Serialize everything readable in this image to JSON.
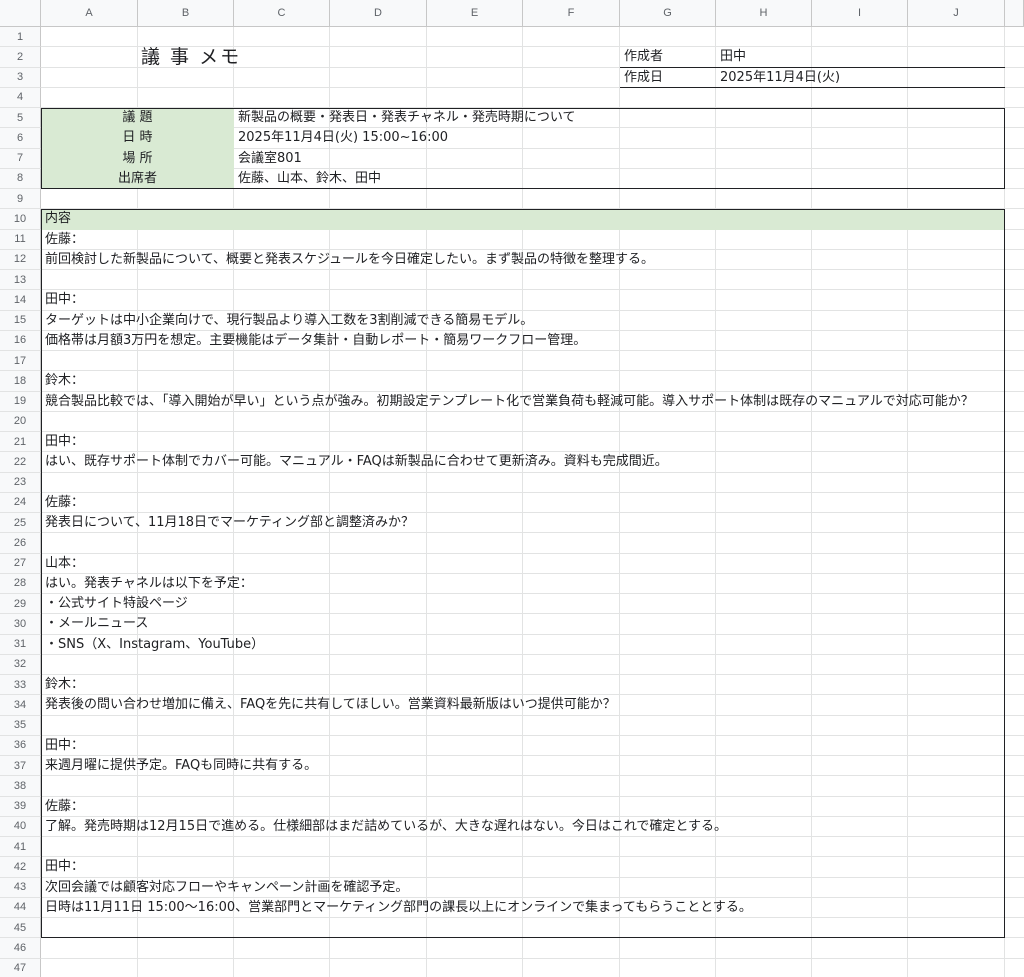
{
  "columns": [
    "A",
    "B",
    "C",
    "D",
    "E",
    "F",
    "G",
    "H",
    "I",
    "J"
  ],
  "rows": [
    "1",
    "2",
    "3",
    "4",
    "5",
    "6",
    "7",
    "8",
    "9",
    "10",
    "11",
    "12",
    "13",
    "14",
    "15",
    "16",
    "17",
    "18",
    "19",
    "20",
    "21",
    "22",
    "23",
    "24",
    "25",
    "26",
    "27",
    "28",
    "29",
    "30",
    "31",
    "32",
    "33",
    "34",
    "35",
    "36",
    "37",
    "38",
    "39",
    "40",
    "41",
    "42",
    "43",
    "44",
    "45",
    "46",
    "47"
  ],
  "header": {
    "title": "議 事 メモ",
    "author_label": "作成者",
    "author_value": "田中",
    "date_label": "作成日",
    "date_value": "2025年11月4日(火)"
  },
  "info": [
    {
      "label": "議 題",
      "value": "新製品の概要・発表日・発表チャネル・発売時期について"
    },
    {
      "label": "日 時",
      "value": "2025年11月4日(火) 15:00~16:00"
    },
    {
      "label": "場 所",
      "value": "会議室801"
    },
    {
      "label": "出席者",
      "value": "佐藤、山本、鈴木、田中"
    }
  ],
  "content_header": "内容",
  "content_lines": [
    "佐藤：",
    "前回検討した新製品について、概要と発表スケジュールを今日確定したい。まず製品の特徴を整理する。",
    "",
    "田中：",
    "ターゲットは中小企業向けで、現行製品より導入工数を3割削減できる簡易モデル。",
    "価格帯は月額3万円を想定。主要機能はデータ集計・自動レポート・簡易ワークフロー管理。",
    "",
    "鈴木：",
    "競合製品比較では、「導入開始が早い」という点が強み。初期設定テンプレート化で営業負荷も軽減可能。導入サポート体制は既存のマニュアルで対応可能か？",
    "",
    "田中：",
    "はい、既存サポート体制でカバー可能。マニュアル・FAQは新製品に合わせて更新済み。資料も完成間近。",
    "",
    "佐藤：",
    "発表日について、11月18日でマーケティング部と調整済みか？",
    "",
    "山本：",
    "はい。発表チャネルは以下を予定：",
    "・公式サイト特設ページ",
    "・メールニュース",
    "・SNS（X、Instagram、YouTube）",
    "",
    "鈴木：",
    "発表後の問い合わせ増加に備え、FAQを先に共有してほしい。営業資料最新版はいつ提供可能か？",
    "",
    "田中：",
    "来週月曜に提供予定。FAQも同時に共有する。",
    "",
    "佐藤：",
    "了解。発売時期は12月15日で進める。仕様細部はまだ詰めているが、大きな遅れはない。今日はこれで確定とする。",
    "",
    "田中：",
    "次回会議では顧客対応フローやキャンペーン計画を確認予定。",
    "日時は11月11日 15:00～16:00、営業部門とマーケティング部門の課長以上にオンラインで集まってもらうこととする。"
  ]
}
